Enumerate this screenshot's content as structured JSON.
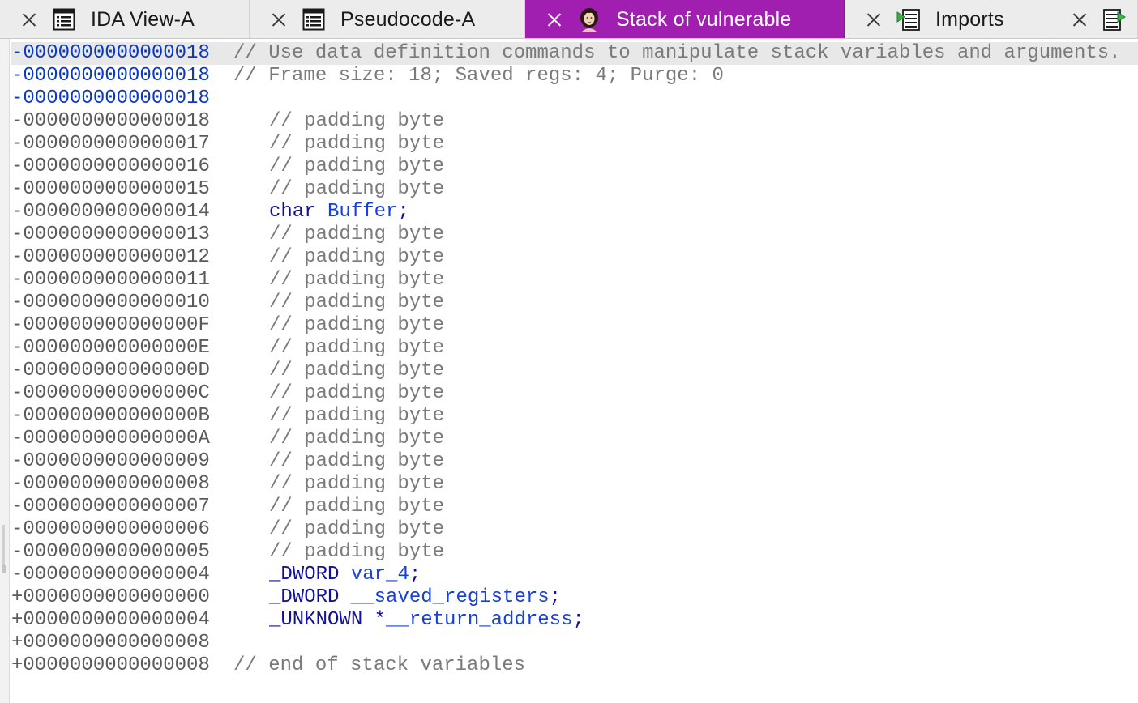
{
  "tabs": [
    {
      "label": "IDA View-A",
      "icon": "listing-icon",
      "active": false
    },
    {
      "label": "Pseudocode-A",
      "icon": "listing-icon",
      "active": false
    },
    {
      "label": "Stack of vulnerable",
      "icon": "lady-portrait-icon",
      "active": true
    },
    {
      "label": "Imports",
      "icon": "imports-icon",
      "active": false
    },
    {
      "label": "",
      "icon": "exports-icon",
      "active": false
    }
  ],
  "colors": {
    "active_tab": "#a01fb0",
    "address_highlight": "#0b38c8",
    "address": "#5a5a5a",
    "comment": "#7a7a7a",
    "keyword": "#10109a",
    "identifier": "#1840d8"
  },
  "listing": [
    {
      "addr": "-0000000000000018",
      "highlight": true,
      "current": true,
      "kind": "comment",
      "text": "// Use data definition commands to manipulate stack variables and arguments."
    },
    {
      "addr": "-0000000000000018",
      "highlight": true,
      "kind": "comment",
      "text": "// Frame size: 18; Saved regs: 4; Purge: 0"
    },
    {
      "addr": "-0000000000000018",
      "highlight": true,
      "kind": "empty",
      "text": ""
    },
    {
      "addr": "-0000000000000018",
      "kind": "member-comment",
      "text": "// padding byte"
    },
    {
      "addr": "-0000000000000017",
      "kind": "member-comment",
      "text": "// padding byte"
    },
    {
      "addr": "-0000000000000016",
      "kind": "member-comment",
      "text": "// padding byte"
    },
    {
      "addr": "-0000000000000015",
      "kind": "member-comment",
      "text": "// padding byte"
    },
    {
      "addr": "-0000000000000014",
      "kind": "decl",
      "type": "char",
      "name": "Buffer",
      "prefix": "",
      "end": ";"
    },
    {
      "addr": "-0000000000000013",
      "kind": "member-comment",
      "text": "// padding byte"
    },
    {
      "addr": "-0000000000000012",
      "kind": "member-comment",
      "text": "// padding byte"
    },
    {
      "addr": "-0000000000000011",
      "kind": "member-comment",
      "text": "// padding byte"
    },
    {
      "addr": "-0000000000000010",
      "kind": "member-comment",
      "text": "// padding byte"
    },
    {
      "addr": "-000000000000000F",
      "kind": "member-comment",
      "text": "// padding byte"
    },
    {
      "addr": "-000000000000000E",
      "kind": "member-comment",
      "text": "// padding byte"
    },
    {
      "addr": "-000000000000000D",
      "kind": "member-comment",
      "text": "// padding byte"
    },
    {
      "addr": "-000000000000000C",
      "kind": "member-comment",
      "text": "// padding byte"
    },
    {
      "addr": "-000000000000000B",
      "kind": "member-comment",
      "text": "// padding byte"
    },
    {
      "addr": "-000000000000000A",
      "kind": "member-comment",
      "text": "// padding byte"
    },
    {
      "addr": "-0000000000000009",
      "kind": "member-comment",
      "text": "// padding byte"
    },
    {
      "addr": "-0000000000000008",
      "kind": "member-comment",
      "text": "// padding byte"
    },
    {
      "addr": "-0000000000000007",
      "kind": "member-comment",
      "text": "// padding byte"
    },
    {
      "addr": "-0000000000000006",
      "kind": "member-comment",
      "text": "// padding byte"
    },
    {
      "addr": "-0000000000000005",
      "kind": "member-comment",
      "text": "// padding byte"
    },
    {
      "addr": "-0000000000000004",
      "kind": "decl",
      "type": "_DWORD",
      "name": "var_4",
      "prefix": "",
      "end": ";"
    },
    {
      "addr": "+0000000000000000",
      "kind": "decl",
      "type": "_DWORD",
      "name": "__saved_registers",
      "prefix": "",
      "end": ";"
    },
    {
      "addr": "+0000000000000004",
      "kind": "decl",
      "type": "_UNKNOWN",
      "name": "__return_address",
      "prefix": "*",
      "end": ";"
    },
    {
      "addr": "+0000000000000008",
      "kind": "empty",
      "text": ""
    },
    {
      "addr": "+0000000000000008",
      "kind": "comment",
      "text": "// end of stack variables"
    }
  ]
}
